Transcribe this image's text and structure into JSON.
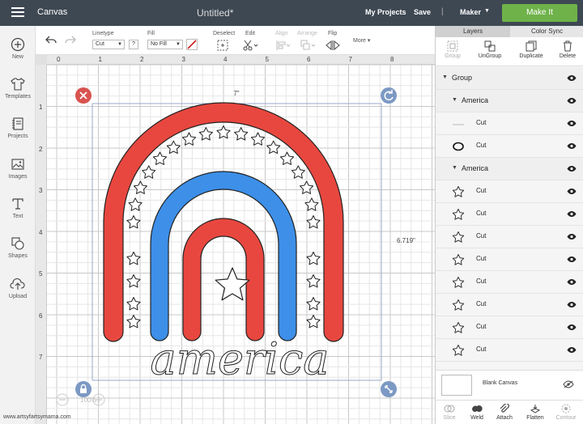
{
  "topbar": {
    "app_title": "Canvas",
    "doc_title": "Untitled*",
    "my_projects": "My Projects",
    "save": "Save",
    "separator": "|",
    "machine": "Maker",
    "make_it": "Make It",
    "make_it_color": "#6fb24a",
    "bar_color": "#3e4853"
  },
  "leftbar": {
    "items": [
      {
        "label": "New",
        "icon": "plus-circle-icon"
      },
      {
        "label": "Templates",
        "icon": "shirt-icon"
      },
      {
        "label": "Projects",
        "icon": "notebook-icon"
      },
      {
        "label": "Images",
        "icon": "image-icon"
      },
      {
        "label": "Text",
        "icon": "text-t-icon"
      },
      {
        "label": "Shapes",
        "icon": "shapes-icon"
      },
      {
        "label": "Upload",
        "icon": "upload-cloud-icon"
      }
    ]
  },
  "toolbar": {
    "linetype_label": "Linetype",
    "linetype_value": "Cut",
    "fill_label": "Fill",
    "fill_value": "No Fill",
    "deselect_label": "Deselect",
    "edit_label": "Edit",
    "align_label": "Align",
    "arrange_label": "Arrange",
    "flip_label": "Flip",
    "more_label": "More"
  },
  "ruler": {
    "top": [
      "0",
      "1",
      "2",
      "3",
      "4",
      "5",
      "6",
      "7",
      "8"
    ],
    "left": [
      "1",
      "2",
      "3",
      "4",
      "5",
      "6",
      "7"
    ]
  },
  "canvas": {
    "width_label": "7\"",
    "height_label": "6.719\"",
    "zoom": "100%",
    "word": "america",
    "colors": {
      "red": "#e8473f",
      "blue": "#3d8fe8",
      "outline": "#222222",
      "selection": "#9aa8c8"
    }
  },
  "panel": {
    "tabs": [
      "Layers",
      "Color Sync"
    ],
    "actions": [
      "Group",
      "UnGroup",
      "Duplicate",
      "Delete"
    ],
    "group_label": "Group",
    "layers": [
      {
        "type": "group",
        "name": "Group"
      },
      {
        "type": "subgroup",
        "name": "America"
      },
      {
        "type": "cut",
        "name": "Cut",
        "thumb": "text"
      },
      {
        "type": "cut",
        "name": "Cut",
        "thumb": "ellipse"
      },
      {
        "type": "subgroup",
        "name": "America"
      },
      {
        "type": "cut",
        "name": "Cut",
        "thumb": "star"
      },
      {
        "type": "cut",
        "name": "Cut",
        "thumb": "star"
      },
      {
        "type": "cut",
        "name": "Cut",
        "thumb": "star"
      },
      {
        "type": "cut",
        "name": "Cut",
        "thumb": "star"
      },
      {
        "type": "cut",
        "name": "Cut",
        "thumb": "star"
      },
      {
        "type": "cut",
        "name": "Cut",
        "thumb": "star"
      },
      {
        "type": "cut",
        "name": "Cut",
        "thumb": "star"
      },
      {
        "type": "cut",
        "name": "Cut",
        "thumb": "star"
      }
    ],
    "blank_canvas": "Blank Canvas",
    "bottom_actions": [
      "Slice",
      "Weld",
      "Attach",
      "Flatten",
      "Contour"
    ]
  },
  "watermark": "www.artsyfartsymama.com"
}
